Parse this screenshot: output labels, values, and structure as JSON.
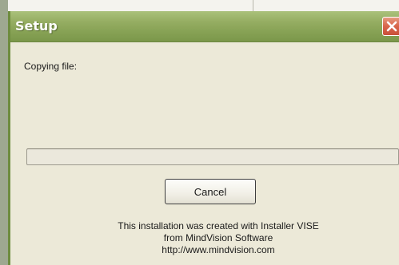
{
  "window": {
    "title": "Setup"
  },
  "copying_label": "Copying file:",
  "progress": {
    "percent": 0
  },
  "buttons": {
    "cancel_label": "Cancel"
  },
  "credits": {
    "line1": "This installation was created with Installer VISE",
    "line2": "from MindVision Software",
    "line3": "http://www.mindvision.com"
  },
  "icons": {
    "close": "close-icon"
  },
  "colors": {
    "titlebar": "#8aa556",
    "close_button": "#d8654a",
    "dialog_background": "#ece9d8"
  }
}
